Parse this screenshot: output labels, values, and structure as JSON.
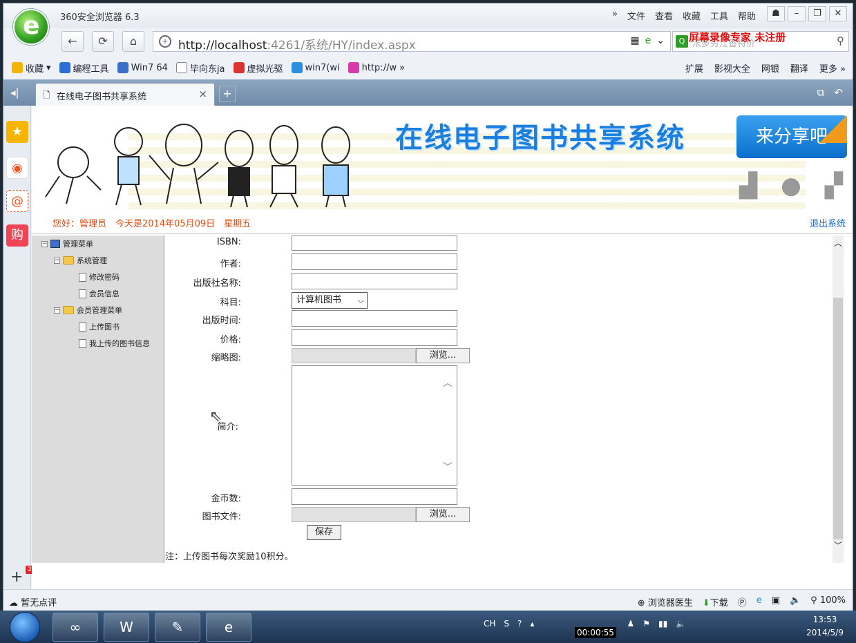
{
  "browser": {
    "title": "360安全浏览器 6.3",
    "menu": [
      "»",
      "文件",
      "查看",
      "收藏",
      "工具",
      "帮助"
    ],
    "url_host": "http://localhost",
    "url_rest": ":4261/系统/HY/index.aspx",
    "search_placeholder": "法多穷江香特价",
    "watermark": "屏幕录像专家 未注册"
  },
  "bookmarks": [
    {
      "label": "收藏",
      "icon": "star-icon",
      "color": "#f5b400"
    },
    {
      "label": "编程工具",
      "icon": "tool-icon",
      "color": "#2a6fd1"
    },
    {
      "label": "Win7 64",
      "icon": "paw-icon",
      "color": "#3b6fc9"
    },
    {
      "label": "毕向东ja",
      "icon": "page-icon",
      "color": "#ffffff"
    },
    {
      "label": "虚拟光驱",
      "icon": "disc-icon",
      "color": "#d33"
    },
    {
      "label": "win7(wi",
      "icon": "ie-icon",
      "color": "#2a8fe0"
    },
    {
      "label": "http://w",
      "icon": "flower-icon",
      "color": "#d93aa9"
    }
  ],
  "bookmarks_right": [
    "扩展",
    "影视大全",
    "网银",
    "翻译",
    "更多 »"
  ],
  "tab": {
    "label": "在线电子图书共享系统"
  },
  "site": {
    "title": "在线电子图书共享系统",
    "share_button": "来分享吧",
    "greeting": "您好：管理员　今天是2014年05月09日　星期五",
    "logout": "退出系统"
  },
  "tree": {
    "root": "管理菜单",
    "groups": [
      {
        "label": "系统管理",
        "items": [
          "修改密码",
          "会员信息"
        ]
      },
      {
        "label": "会员管理菜单",
        "items": [
          "上传图书",
          "我上传的图书信息"
        ]
      }
    ]
  },
  "form": {
    "isbn_label": "ISBN:",
    "author_label": "作者:",
    "publisher_label": "出版社名称:",
    "subject_label": "科目:",
    "subject_value": "计算机图书",
    "pubdate_label": "出版时间:",
    "price_label": "价格:",
    "thumb_label": "缩略图:",
    "intro_label": "简介:",
    "coins_label": "金币数:",
    "file_label": "图书文件:",
    "browse_label": "浏览...",
    "save_label": "保存",
    "note": "注：上传图书每次奖励10积分。"
  },
  "status": {
    "left": "暂无点评",
    "doctor": "浏览器医生",
    "download": "下载",
    "zoom": "100%"
  },
  "taskbar": {
    "lang": "CH",
    "time": "13:53",
    "date": "2014/5/9",
    "rec_time": "00:00:55"
  }
}
